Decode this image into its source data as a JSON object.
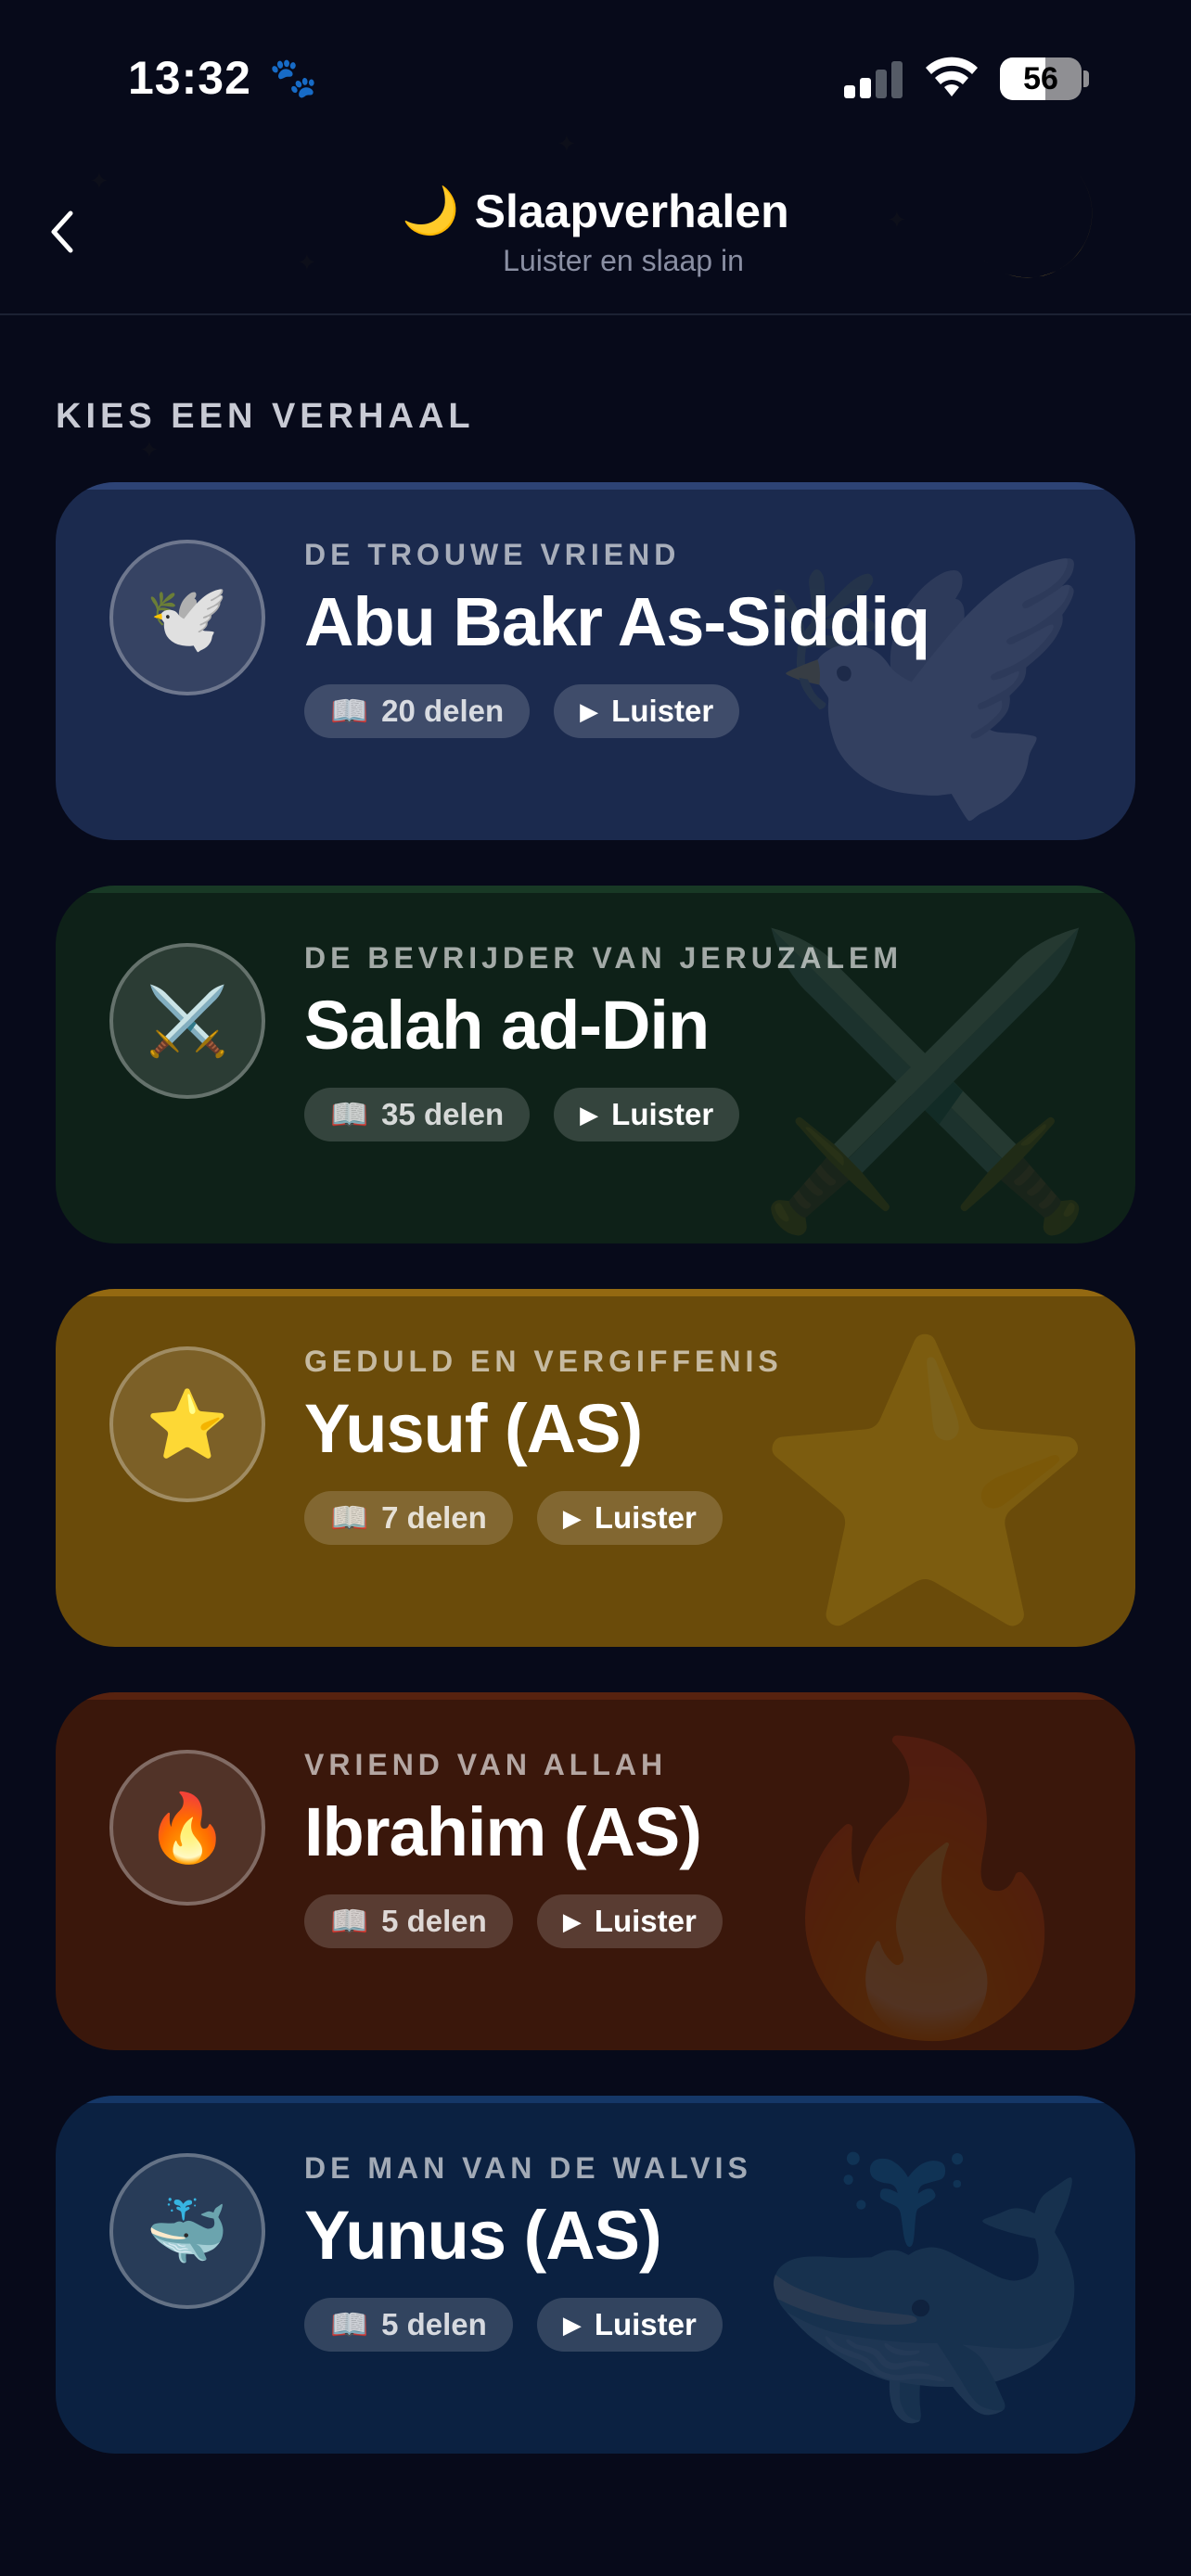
{
  "status": {
    "time": "13:32",
    "paw_icon": "paw-icon",
    "battery": "56"
  },
  "nav": {
    "back_icon": "chevron-left-icon",
    "title_icon": "🌙",
    "title": "Slaapverhalen",
    "subtitle": "Luister en slaap in"
  },
  "section_label": "KIES EEN VERHAAL",
  "stories": [
    {
      "subtitle": "DE TROUWE VRIEND",
      "title": "Abu Bakr As-Siddiq",
      "emoji": "🕊️",
      "icon": "dove-icon",
      "parts": "20 delen",
      "listen": "Luister",
      "color": "#1b2a4e"
    },
    {
      "subtitle": "DE BEVRIJDER VAN JERUZALEM",
      "title": "Salah ad-Din",
      "emoji": "⚔️",
      "icon": "crossed-swords-icon",
      "parts": "35 delen",
      "listen": "Luister",
      "color": "#0e2118"
    },
    {
      "subtitle": "GEDULD EN VERGIFFENIS",
      "title": "Yusuf (AS)",
      "emoji": "⭐",
      "icon": "star-icon",
      "parts": "7 delen",
      "listen": "Luister",
      "color": "#6a4b0a"
    },
    {
      "subtitle": "VRIEND VAN ALLAH",
      "title": "Ibrahim (AS)",
      "emoji": "🔥",
      "icon": "fire-icon",
      "parts": "5 delen",
      "listen": "Luister",
      "color": "#3a170b"
    },
    {
      "subtitle": "DE MAN VAN DE WALVIS",
      "title": "Yunus (AS)",
      "emoji": "🐳",
      "icon": "whale-icon",
      "parts": "5 delen",
      "listen": "Luister",
      "color": "#0b2141"
    }
  ],
  "book_icon": "📖",
  "play_icon": "▶"
}
